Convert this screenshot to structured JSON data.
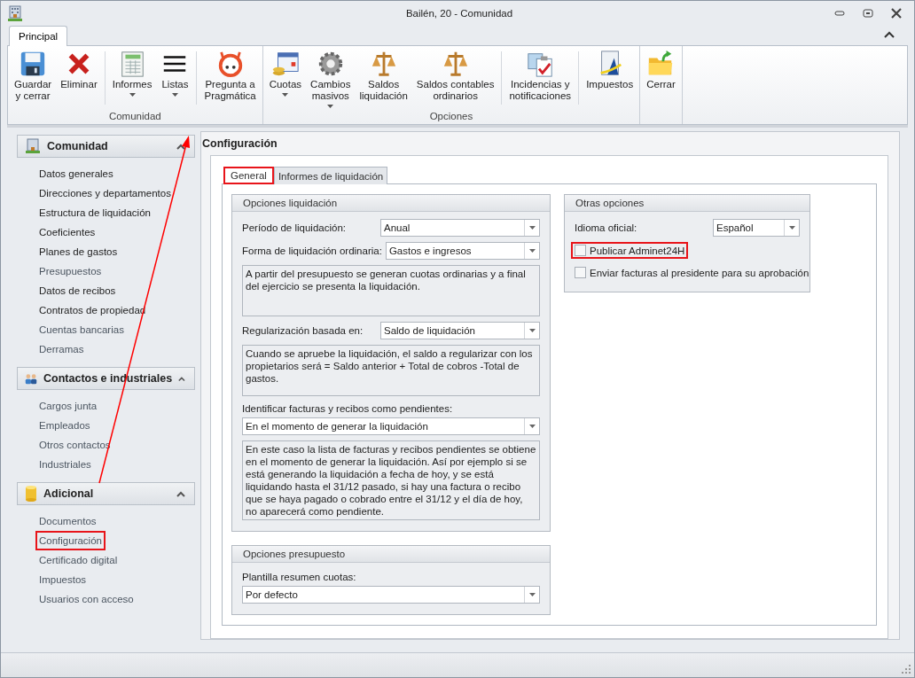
{
  "window": {
    "title": "Bailén, 20 - Comunidad"
  },
  "ribbon": {
    "tabs": [
      {
        "label": "Principal",
        "selected": true
      }
    ],
    "groups": [
      {
        "label": "Comunidad",
        "buttons": [
          {
            "label": "Guardar\ny cerrar",
            "dropdown": false
          },
          {
            "label": "Eliminar",
            "dropdown": false
          },
          {
            "label": "Informes",
            "dropdown": true
          },
          {
            "label": "Listas",
            "dropdown": true
          },
          {
            "label": "Pregunta a\nPragmática",
            "dropdown": false
          }
        ]
      },
      {
        "label": "Opciones",
        "buttons": [
          {
            "label": "Cuotas",
            "dropdown": true
          },
          {
            "label": "Cambios\nmasivos",
            "dropdown": true
          },
          {
            "label": "Saldos\nliquidación",
            "dropdown": false
          },
          {
            "label": "Saldos contables\nordinarios",
            "dropdown": false
          },
          {
            "label": "Incidencias y\nnotificaciones",
            "dropdown": false
          },
          {
            "label": "Impuestos",
            "dropdown": false
          }
        ]
      },
      {
        "buttons": [
          {
            "label": "Cerrar",
            "dropdown": false
          }
        ]
      }
    ]
  },
  "sidebar": {
    "sections": [
      {
        "title": "Comunidad",
        "expanded": true,
        "items": [
          {
            "label": "Datos generales",
            "disabled": false,
            "highlighted": false
          },
          {
            "label": "Direcciones y departamentos",
            "disabled": false,
            "highlighted": false
          },
          {
            "label": "Estructura de liquidación",
            "disabled": false,
            "highlighted": false
          },
          {
            "label": "Coeficientes",
            "disabled": false,
            "highlighted": false
          },
          {
            "label": "Planes de gastos",
            "disabled": false,
            "highlighted": false
          },
          {
            "label": "Presupuestos",
            "disabled": true,
            "highlighted": false
          },
          {
            "label": "Datos de recibos",
            "disabled": false,
            "highlighted": false
          },
          {
            "label": "Contratos de propiedad",
            "disabled": false,
            "highlighted": false
          },
          {
            "label": "Cuentas bancarias",
            "disabled": true,
            "highlighted": false
          },
          {
            "label": "Derramas",
            "disabled": true,
            "highlighted": false
          }
        ]
      },
      {
        "title": "Contactos e industriales",
        "expanded": true,
        "items": [
          {
            "label": "Cargos junta",
            "disabled": true,
            "highlighted": false
          },
          {
            "label": "Empleados",
            "disabled": true,
            "highlighted": false
          },
          {
            "label": "Otros contactos",
            "disabled": true,
            "highlighted": false
          },
          {
            "label": "Industriales",
            "disabled": true,
            "highlighted": false
          }
        ]
      },
      {
        "title": "Adicional",
        "expanded": true,
        "items": [
          {
            "label": "Documentos",
            "disabled": true,
            "highlighted": false
          },
          {
            "label": "Configuración",
            "disabled": true,
            "highlighted": true
          },
          {
            "label": "Certificado digital",
            "disabled": true,
            "highlighted": false
          },
          {
            "label": "Impuestos",
            "disabled": true,
            "highlighted": false
          },
          {
            "label": "Usuarios con acceso",
            "disabled": true,
            "highlighted": false
          }
        ]
      }
    ]
  },
  "content": {
    "title": "Configuración",
    "tabs": [
      {
        "label": "General",
        "selected": true,
        "highlighted": true
      },
      {
        "label": "Informes de liquidación",
        "selected": false,
        "highlighted": false
      }
    ],
    "left_panels": [
      {
        "title": "Opciones liquidación",
        "fields": [
          {
            "kind": "inline-select",
            "label": "Período de liquidación:",
            "value": "Anual"
          },
          {
            "kind": "inline-select",
            "label": "Forma de liquidación ordinaria:",
            "value": "Gastos e ingresos"
          },
          {
            "kind": "note",
            "text": "A partir del presupuesto se generan cuotas ordinarias y a final del ejercicio se presenta la liquidación."
          },
          {
            "kind": "inline-select",
            "label": "Regularización basada en:",
            "value": "Saldo de liquidación"
          },
          {
            "kind": "note",
            "text": "Cuando se apruebe la liquidación, el saldo a regularizar con los propietarios será = Saldo anterior + Total de cobros -Total de gastos."
          },
          {
            "kind": "stacked-select",
            "label": "Identificar facturas y recibos como pendientes:",
            "value": "En el momento de generar la liquidación"
          },
          {
            "kind": "note",
            "text": "En este caso la lista de facturas y recibos pendientes se obtiene en el momento de generar la liquidación. Así por ejemplo si se está generando la liquidación a fecha de hoy, y se está liquidando hasta el 31/12 pasado, si hay una factura o recibo que se haya pagado o cobrado entre el 31/12 y el día de hoy, no aparecerá como pendiente."
          }
        ]
      },
      {
        "title": "Opciones presupuesto",
        "fields": [
          {
            "kind": "stacked-select",
            "label": "Plantilla resumen cuotas:",
            "value": "Por defecto"
          }
        ]
      }
    ],
    "right_panels": [
      {
        "title": "Otras opciones",
        "fields": [
          {
            "kind": "inline-select",
            "label": "Idioma oficial:",
            "value": "Español"
          },
          {
            "kind": "checkbox",
            "label": "Publicar Adminet24H",
            "checked": false,
            "highlighted": true
          },
          {
            "kind": "checkbox",
            "label": "Enviar facturas al presidente para su aprobación",
            "checked": false,
            "highlighted": false
          }
        ]
      }
    ]
  }
}
